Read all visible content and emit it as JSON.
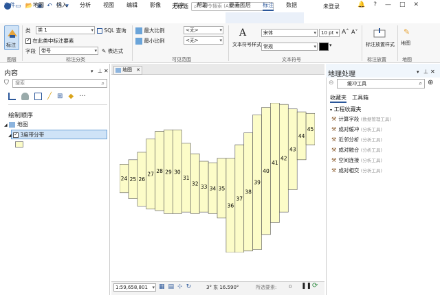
{
  "app": {
    "title": "无标题",
    "search_placeholder": "命令搜索 (Alt+Q)",
    "user": "未登录"
  },
  "window_controls": [
    "?",
    "—",
    "□",
    "✕"
  ],
  "tabs": {
    "file": "文件",
    "items": [
      "地图",
      "插入",
      "分析",
      "视图",
      "编辑",
      "影像",
      "共享",
      "帮助"
    ],
    "context": [
      "要素图层",
      "标注",
      "数据"
    ],
    "active": "标注"
  },
  "ribbon": {
    "label_button": "标注",
    "layer_group": "图层",
    "class_label": "类",
    "class_value": "类 1",
    "sql_query": "SQL 查询",
    "label_in_class": "在此类中标注要素",
    "field_label": "字段",
    "field_value": "带号",
    "expression": "表达式",
    "label_class_group": "标注分类",
    "max_scale": "最大比例",
    "min_scale": "最小比例",
    "scale_none_1": "<无>",
    "scale_none_2": "<无>",
    "visible_range_group": "可见范围",
    "text_symbol_style": "文本符号样式",
    "font_value": "宋体",
    "size_value": "10 pt",
    "style_value": "常规",
    "text_symbol_group": "文本符号",
    "label_placement_style": "标注放置样式",
    "label_placement_group": "标注放置",
    "map_button": "地图",
    "map_group": "地图"
  },
  "content_pane": {
    "title": "内容",
    "search_placeholder": "搜索",
    "drawing_order": "绘制顺序",
    "map_item": "地图",
    "layer_item": "3度带分带"
  },
  "map_view": {
    "tab_label": "地图"
  },
  "zones": [
    {
      "label": "24",
      "top": 0.41,
      "bottom": 0.6
    },
    {
      "label": "25",
      "top": 0.38,
      "bottom": 0.64
    },
    {
      "label": "26",
      "top": 0.33,
      "bottom": 0.69
    },
    {
      "label": "27",
      "top": 0.24,
      "bottom": 0.71
    },
    {
      "label": "28",
      "top": 0.19,
      "bottom": 0.72
    },
    {
      "label": "29",
      "top": 0.18,
      "bottom": 0.74
    },
    {
      "label": "30",
      "top": 0.18,
      "bottom": 0.74
    },
    {
      "label": "31",
      "top": 0.27,
      "bottom": 0.73
    },
    {
      "label": "32",
      "top": 0.34,
      "bottom": 0.74
    },
    {
      "label": "33",
      "top": 0.39,
      "bottom": 0.73
    },
    {
      "label": "34",
      "top": 0.4,
      "bottom": 0.74
    },
    {
      "label": "35",
      "top": 0.37,
      "bottom": 0.77
    },
    {
      "label": "36",
      "top": 0.37,
      "bottom": 1.0
    },
    {
      "label": "37",
      "top": 0.28,
      "bottom": 1.0
    },
    {
      "label": "38",
      "top": 0.2,
      "bottom": 0.99
    },
    {
      "label": "39",
      "top": 0.08,
      "bottom": 0.98
    },
    {
      "label": "40",
      "top": 0.03,
      "bottom": 0.88
    },
    {
      "label": "41",
      "top": 0.0,
      "bottom": 0.8
    },
    {
      "label": "42",
      "top": 0.01,
      "bottom": 0.73
    },
    {
      "label": "43",
      "top": 0.04,
      "bottom": 0.58
    },
    {
      "label": "44",
      "top": 0.06,
      "bottom": 0.38
    },
    {
      "label": "45",
      "top": 0.07,
      "bottom": 0.28
    }
  ],
  "status_bar": {
    "scale": "1:59,658,801",
    "coords": "3° 东 16.590°",
    "selected": "所选要素:",
    "selected_count": "0"
  },
  "geoprocessing": {
    "title": "地理处理",
    "search_placeholder": "缓冲工具",
    "tab_favorites": "收藏夹",
    "tab_toolbox": "工具箱",
    "group": "工程收藏夹",
    "tools": [
      {
        "name": "计算字段",
        "category": "(数据管理工具)"
      },
      {
        "name": "成对缓冲",
        "category": "(分析工具)"
      },
      {
        "name": "近邻分析",
        "category": "(分析工具)"
      },
      {
        "name": "成对融合",
        "category": "(分析工具)"
      },
      {
        "name": "空间连接",
        "category": "(分析工具)"
      },
      {
        "name": "成对相交",
        "category": "(分析工具)"
      }
    ]
  }
}
